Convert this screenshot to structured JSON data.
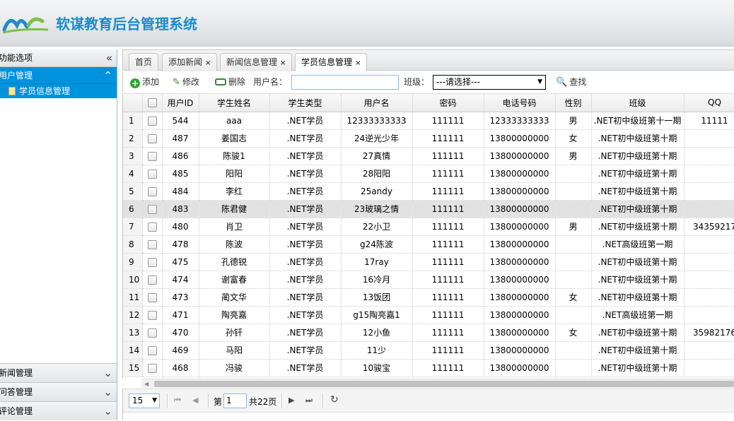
{
  "header": {
    "title": "软谋教育后台管理系统"
  },
  "sidebar": {
    "title": "功能选项",
    "groups": [
      {
        "label": "用户管理",
        "items": [
          {
            "label": "学员信息管理"
          }
        ]
      },
      {
        "label": "新闻管理"
      },
      {
        "label": "问答管理"
      },
      {
        "label": "评论管理"
      }
    ]
  },
  "tabs": [
    {
      "label": "首页"
    },
    {
      "label": "添加新闻"
    },
    {
      "label": "新闻信息管理"
    },
    {
      "label": "学员信息管理"
    }
  ],
  "toolbar": {
    "add": "添加",
    "edit": "修改",
    "delete": "删除",
    "username_label": "用户名：",
    "username_value": "",
    "class_label": "班级：",
    "class_selected": "---请选择---",
    "search": "查找"
  },
  "grid": {
    "columns": [
      "用户ID",
      "学生姓名",
      "学生类型",
      "用户名",
      "密码",
      "电话号码",
      "性别",
      "班级",
      "QQ"
    ],
    "rows": [
      [
        "1",
        "544",
        "aaa",
        ".NET学员",
        "12333333333",
        "111111",
        "12333333333",
        "男",
        ".NET初中级班第十一期",
        "11111"
      ],
      [
        "2",
        "487",
        "姜国志",
        ".NET学员",
        "24逆光少年",
        "111111",
        "13800000000",
        "女",
        ".NET初中级班第十期",
        ""
      ],
      [
        "3",
        "486",
        "陈骏1",
        ".NET学员",
        "27真情",
        "111111",
        "13800000000",
        "男",
        ".NET初中级班第十期",
        ""
      ],
      [
        "4",
        "485",
        "阳阳",
        ".NET学员",
        "28阳阳",
        "111111",
        "13800000000",
        "",
        ".NET初中级班第十期",
        ""
      ],
      [
        "5",
        "484",
        "李红",
        ".NET学员",
        "25andy",
        "111111",
        "13800000000",
        "",
        ".NET初中级班第十期",
        ""
      ],
      [
        "6",
        "483",
        "陈君健",
        ".NET学员",
        "23玻璃之情",
        "111111",
        "13800000000",
        "",
        ".NET初中级班第十期",
        ""
      ],
      [
        "7",
        "480",
        "肖卫",
        ".NET学员",
        "22小卫",
        "111111",
        "13800000000",
        "男",
        ".NET初中级班第十期",
        "34359217"
      ],
      [
        "8",
        "478",
        "陈波",
        ".NET学员",
        "g24陈波",
        "111111",
        "13800000000",
        "",
        ".NET高级班第一期",
        ""
      ],
      [
        "9",
        "475",
        "孔德锐",
        ".NET学员",
        "17ray",
        "111111",
        "13800000000",
        "",
        ".NET初中级班第十期",
        ""
      ],
      [
        "10",
        "474",
        "谢富春",
        ".NET学员",
        "16冷月",
        "111111",
        "13800000000",
        "",
        ".NET初中级班第十期",
        ""
      ],
      [
        "11",
        "473",
        "蔺文华",
        ".NET学员",
        "13饭团",
        "111111",
        "13800000000",
        "女",
        ".NET初中级班第十期",
        ""
      ],
      [
        "12",
        "471",
        "陶亮嘉",
        ".NET学员",
        "g15陶亮嘉1",
        "111111",
        "13800000000",
        "",
        ".NET高级班第一期",
        ""
      ],
      [
        "13",
        "470",
        "孙钎",
        ".NET学员",
        "12小鱼",
        "111111",
        "13800000000",
        "女",
        ".NET初中级班第十期",
        "35982176"
      ],
      [
        "14",
        "469",
        "马阳",
        ".NET学员",
        "11少",
        "111111",
        "13800000000",
        "",
        ".NET初中级班第十期",
        ""
      ],
      [
        "15",
        "468",
        "冯骏",
        ".NET学员",
        "10骏宝",
        "111111",
        "13800000000",
        "",
        ".NET初中级班第十期",
        ""
      ]
    ],
    "highlight_row": 6
  },
  "pager": {
    "page_size": "15",
    "page_label": "第",
    "page_value": "1",
    "total_pages": "共22页"
  }
}
